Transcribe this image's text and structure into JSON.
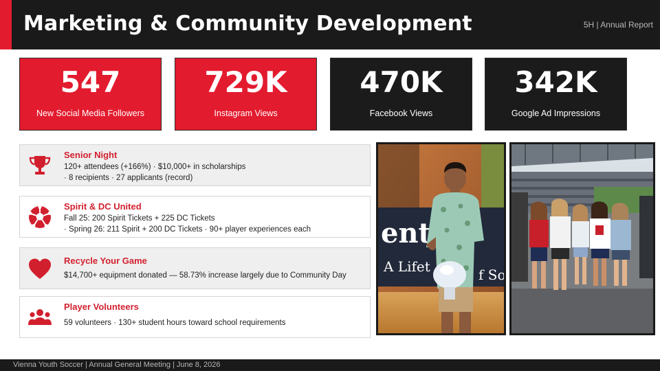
{
  "header": {
    "title": "Marketing & Community Development",
    "tag": "5H | Annual Report"
  },
  "stats": [
    {
      "value": "547",
      "label": "New Social Media Followers"
    },
    {
      "value": "729K",
      "label": "Instagram Views"
    },
    {
      "value": "470K",
      "label": "Facebook Views"
    },
    {
      "value": "342K",
      "label": "Google Ad Impressions"
    }
  ],
  "highlights": [
    {
      "title": "Senior Night",
      "icon": "trophy-icon",
      "lines": [
        "120+ attendees (+166%) · $10,000+ in scholarships",
        "· 8 recipients · 27 applicants (record)"
      ]
    },
    {
      "title": "Spirit & DC United",
      "icon": "soccer-ball-icon",
      "lines": [
        "Fall 25: 200 Spirit Tickets + 225 DC Tickets",
        "· Spring 26: 211 Spirit + 200 DC Tickets · 90+ player experiences each"
      ]
    },
    {
      "title": "Recycle Your Game",
      "icon": "heart-icon",
      "lines": [
        "$14,700+ equipment donated — 58.73% increase largely due to Community Day"
      ]
    },
    {
      "title": "Player Volunteers",
      "icon": "people-icon",
      "lines": [
        "59 volunteers · 130+ student hours toward school requirements"
      ]
    }
  ],
  "photos": {
    "left_banner_text": "ent",
    "left_banner_subtext": "A Lifet",
    "left_banner_subtext_2": "f So"
  },
  "footer": {
    "text": "Vienna Youth Soccer  |  Annual General Meeting  |  June 8, 2026"
  },
  "colors": {
    "accent_red": "#e31b2e",
    "dark": "#1b1b1b",
    "title_red": "#d21f2d"
  }
}
